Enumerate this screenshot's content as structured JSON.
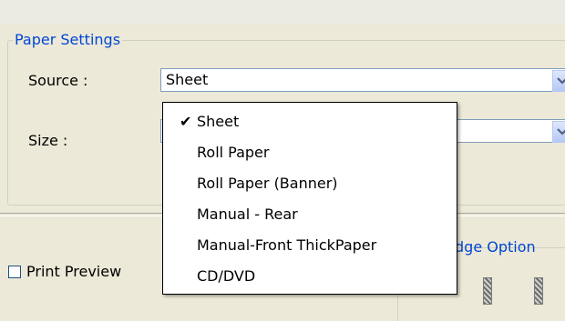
{
  "paper_settings": {
    "title": "Paper Settings",
    "source_label": "Source :",
    "source_value": "Sheet",
    "size_label": "Size :"
  },
  "source_menu": {
    "options": [
      "Sheet",
      "Roll Paper",
      "Roll Paper (Banner)",
      "Manual - Rear",
      "Manual-Front ThickPaper",
      "CD/DVD"
    ],
    "selected": "Sheet"
  },
  "print_preview": {
    "label": "Print Preview",
    "checked": false
  },
  "cartridge": {
    "label_partial": "ridge Option"
  }
}
